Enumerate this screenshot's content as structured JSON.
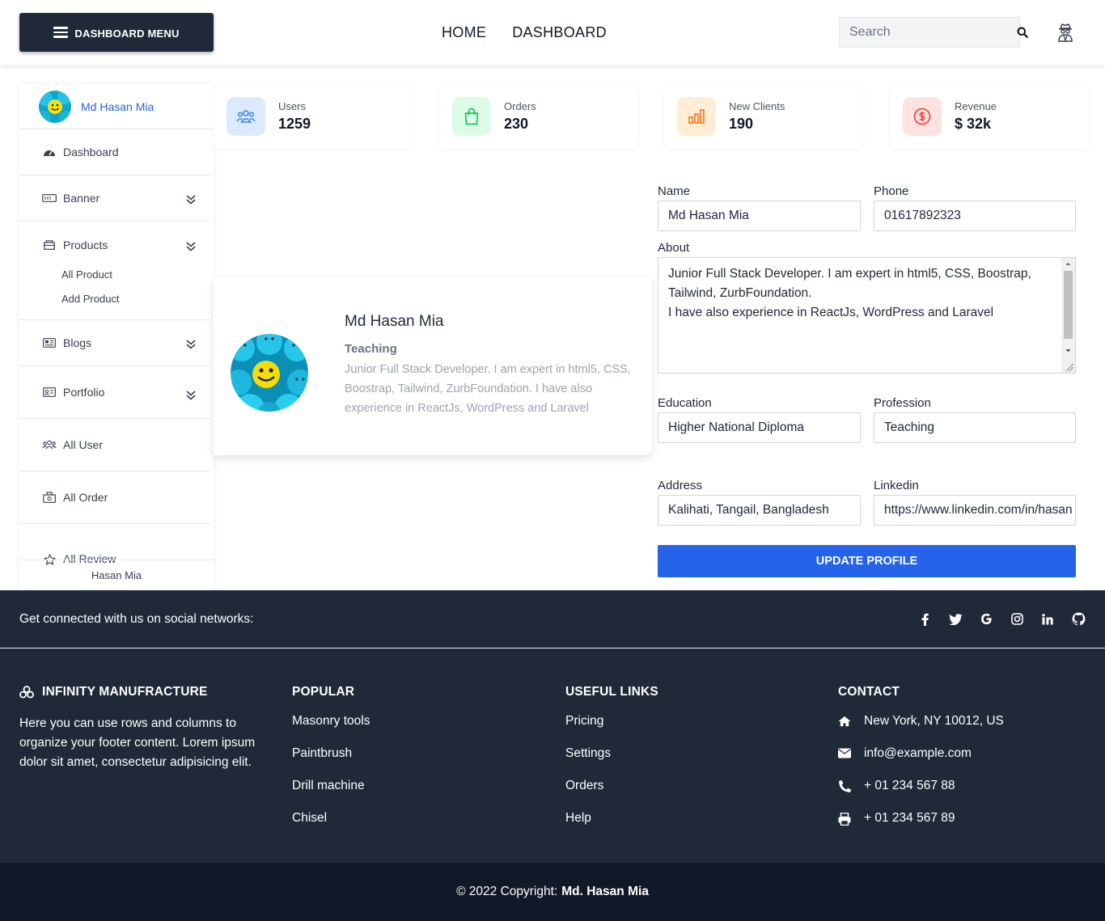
{
  "header": {
    "menu_label": "DASHBOARD MENU",
    "nav": [
      "HOME",
      "DASHBOARD"
    ],
    "search_placeholder": "Search"
  },
  "sidebar": {
    "user_name": "Md Hasan Mia",
    "items": [
      {
        "label": "Dashboard",
        "icon": "gauge-icon"
      },
      {
        "label": "Banner",
        "icon": "banner-icon",
        "expandable": true
      },
      {
        "label": "Products",
        "icon": "box-icon",
        "expandable": true
      },
      {
        "label": "Blogs",
        "icon": "newspaper-icon",
        "expandable": true
      },
      {
        "label": "Portfolio",
        "icon": "id-card-icon",
        "expandable": true
      },
      {
        "label": "All User",
        "icon": "users-icon"
      },
      {
        "label": "All Order",
        "icon": "bag-icon"
      },
      {
        "label": "All Review",
        "icon": "star-icon"
      }
    ],
    "product_sub": [
      "All Product",
      "Add Product"
    ],
    "footer_name": "Hasan Mia"
  },
  "stats": [
    {
      "label": "Users",
      "value": "1259",
      "icon": "users-icon",
      "color": "#3b82f6",
      "bg": "#dbeafe"
    },
    {
      "label": "Orders",
      "value": "230",
      "icon": "bag-icon",
      "color": "#22c55e",
      "bg": "#dcfce7"
    },
    {
      "label": "New Clients",
      "value": "190",
      "icon": "chart-icon",
      "color": "#f97316",
      "bg": "#ffedd5"
    },
    {
      "label": "Revenue",
      "value": "$ 32k",
      "icon": "dollar-icon",
      "color": "#ef4444",
      "bg": "#fee2e2"
    }
  ],
  "profile": {
    "name": "Md Hasan Mia",
    "profession": "Teaching",
    "about": "Junior Full Stack Developer. I am expert in html5, CSS, Boostrap, Tailwind, ZurbFoundation. I have also experience in ReactJs, WordPress and Laravel"
  },
  "form": {
    "name_label": "Name",
    "name_value": "Md Hasan Mia",
    "phone_label": "Phone",
    "phone_value": "01617892323",
    "about_label": "About",
    "about_line1": "Junior Full Stack Developer. I am expert in html5, CSS, Boostrap, Tailwind, ZurbFoundation.",
    "about_line2": "I have also experience in ReactJs, WordPress and Laravel",
    "education_label": "Education",
    "education_value": "Higher National Diploma",
    "profession_label": "Profession",
    "profession_value": "Teaching",
    "address_label": "Address",
    "address_value": "Kalihati, Tangail, Bangladesh",
    "linkedin_label": "Linkedin",
    "linkedin_value": "https://www.linkedin.com/in/hasan",
    "submit_label": "UPDATE PROFILE"
  },
  "footer": {
    "social_text": "Get connected with us on social networks:",
    "social_icons": [
      "facebook-icon",
      "twitter-icon",
      "google-icon",
      "instagram-icon",
      "linkedin-icon",
      "github-icon"
    ],
    "brand": "INFINITY MANUFRACTURE",
    "brand_text": "Here you can use rows and columns to organize your footer content. Lorem ipsum dolor sit amet, consectetur adipisicing elit.",
    "popular_title": "POPULAR",
    "popular": [
      "Masonry tools",
      "Paintbrush",
      "Drill machine",
      "Chisel"
    ],
    "useful_title": "USEFUL LINKS",
    "useful": [
      "Pricing",
      "Settings",
      "Orders",
      "Help"
    ],
    "contact_title": "CONTACT",
    "contact": [
      {
        "icon": "home-icon",
        "text": "New York, NY 10012, US"
      },
      {
        "icon": "envelope-icon",
        "text": "info@example.com"
      },
      {
        "icon": "phone-icon",
        "text": "+ 01 234 567 88"
      },
      {
        "icon": "printer-icon",
        "text": "+ 01 234 567 89"
      }
    ],
    "copyright_prefix": "© 2022 Copyright:",
    "copyright_name": "Md. Hasan Mia"
  }
}
